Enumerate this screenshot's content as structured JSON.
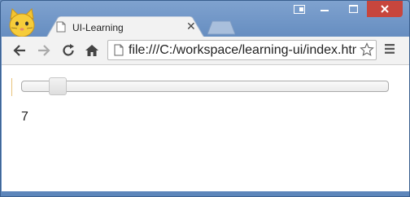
{
  "browser": {
    "tab": {
      "title": "UI-Learning"
    },
    "url": "file:///C:/workspace/learning-ui/index.htm"
  },
  "page": {
    "slider": {
      "min": 0,
      "max": 100,
      "value": 7
    },
    "value_text": "7"
  },
  "colors": {
    "frame": "#5d86bb",
    "close_button": "#c7463d",
    "toolbar": "#f2f2f2",
    "content": "#ffffff"
  },
  "icons": [
    "cat-avatar-icon",
    "profile-switch-icon",
    "minimize-icon",
    "maximize-icon",
    "close-icon",
    "page-icon",
    "tab-close-icon",
    "back-icon",
    "forward-icon",
    "reload-icon",
    "home-icon",
    "star-icon",
    "menu-icon"
  ]
}
